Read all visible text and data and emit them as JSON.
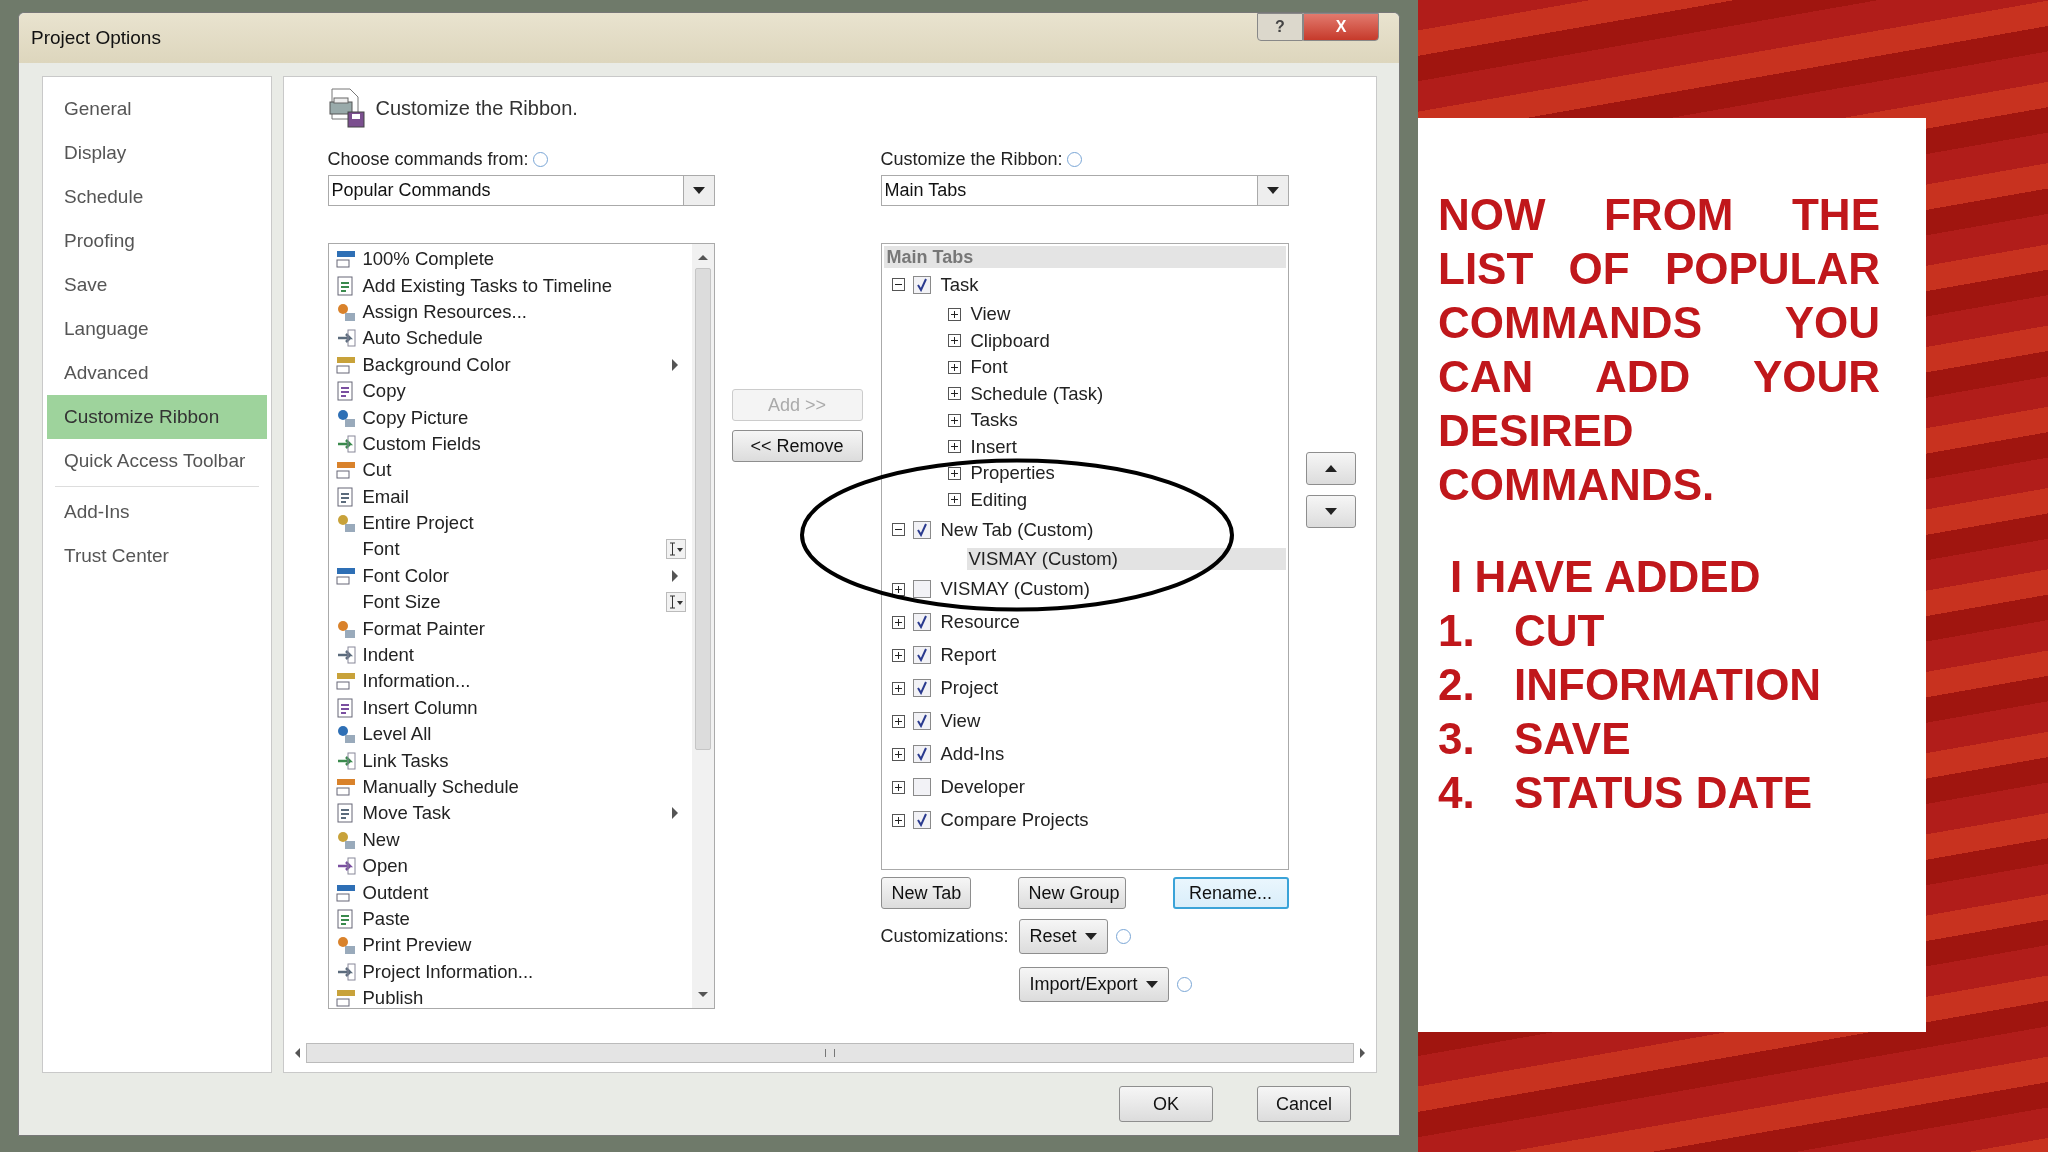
{
  "window": {
    "title": "Project Options",
    "buttons": [
      {
        "kind": "help",
        "label": "?"
      },
      {
        "kind": "close",
        "label": "X"
      }
    ]
  },
  "nav": {
    "groups": [
      [
        {
          "label": "General",
          "selected": false
        },
        {
          "label": "Display",
          "selected": false
        },
        {
          "label": "Schedule",
          "selected": false
        },
        {
          "label": "Proofing",
          "selected": false
        },
        {
          "label": "Save",
          "selected": false
        },
        {
          "label": "Language",
          "selected": false
        },
        {
          "label": "Advanced",
          "selected": false
        },
        {
          "label": "Customize Ribbon",
          "selected": true
        },
        {
          "label": "Quick Access Toolbar",
          "selected": false
        }
      ],
      [
        {
          "label": "Add-Ins",
          "selected": false
        },
        {
          "label": "Trust Center",
          "selected": false
        }
      ]
    ]
  },
  "heading": "Customize the Ribbon.",
  "commands_from": {
    "label": "Choose commands from:",
    "value": "Popular Commands"
  },
  "commands": [
    {
      "label": "100% Complete",
      "icon": true,
      "kind": "plain"
    },
    {
      "label": "Add Existing Tasks to Timeline",
      "icon": true,
      "kind": "plain"
    },
    {
      "label": "Assign Resources...",
      "icon": true,
      "kind": "plain"
    },
    {
      "label": "Auto Schedule",
      "icon": true,
      "kind": "plain"
    },
    {
      "label": "Background Color",
      "icon": true,
      "kind": "menu"
    },
    {
      "label": "Copy",
      "icon": true,
      "kind": "plain"
    },
    {
      "label": "Copy Picture",
      "icon": true,
      "kind": "plain"
    },
    {
      "label": "Custom Fields",
      "icon": true,
      "kind": "plain"
    },
    {
      "label": "Cut",
      "icon": true,
      "kind": "plain"
    },
    {
      "label": "Email",
      "icon": true,
      "kind": "plain"
    },
    {
      "label": "Entire Project",
      "icon": true,
      "kind": "plain"
    },
    {
      "label": "Font",
      "icon": false,
      "kind": "combo"
    },
    {
      "label": "Font Color",
      "icon": true,
      "kind": "menu"
    },
    {
      "label": "Font Size",
      "icon": false,
      "kind": "combo"
    },
    {
      "label": "Format Painter",
      "icon": true,
      "kind": "plain"
    },
    {
      "label": "Indent",
      "icon": true,
      "kind": "plain"
    },
    {
      "label": "Information...",
      "icon": true,
      "kind": "plain"
    },
    {
      "label": "Insert Column",
      "icon": true,
      "kind": "plain"
    },
    {
      "label": "Level All",
      "icon": true,
      "kind": "plain"
    },
    {
      "label": "Link Tasks",
      "icon": true,
      "kind": "plain"
    },
    {
      "label": "Manually Schedule",
      "icon": true,
      "kind": "plain"
    },
    {
      "label": "Move Task",
      "icon": true,
      "kind": "menu"
    },
    {
      "label": "New",
      "icon": true,
      "kind": "plain"
    },
    {
      "label": "Open",
      "icon": true,
      "kind": "plain"
    },
    {
      "label": "Outdent",
      "icon": true,
      "kind": "plain"
    },
    {
      "label": "Paste",
      "icon": true,
      "kind": "plain"
    },
    {
      "label": "Print Preview",
      "icon": true,
      "kind": "plain"
    },
    {
      "label": "Project Information...",
      "icon": true,
      "kind": "plain"
    },
    {
      "label": "Publish",
      "icon": true,
      "kind": "plain"
    }
  ],
  "transfer_buttons": [
    {
      "label": "Add >>",
      "disabled": true
    },
    {
      "label": "<< Remove",
      "disabled": false
    }
  ],
  "ribbon": {
    "label": "Customize the Ribbon:",
    "value": "Main Tabs",
    "tree_header": "Main Tabs",
    "tree": [
      {
        "kind": "tab",
        "label": "Task",
        "checked": true,
        "expanded": true,
        "selected": false,
        "children": [
          {
            "kind": "group",
            "label": "View",
            "selected": false
          },
          {
            "kind": "group",
            "label": "Clipboard",
            "selected": false
          },
          {
            "kind": "group",
            "label": "Font",
            "selected": false
          },
          {
            "kind": "group",
            "label": "Schedule (Task)",
            "selected": false
          },
          {
            "kind": "group",
            "label": "Tasks",
            "selected": false
          },
          {
            "kind": "group",
            "label": "Insert",
            "selected": false
          },
          {
            "kind": "group",
            "label": "Properties",
            "selected": false
          },
          {
            "kind": "group",
            "label": "Editing",
            "selected": false
          }
        ]
      },
      {
        "kind": "tab",
        "label": "New Tab (Custom)",
        "checked": true,
        "expanded": true,
        "selected": false,
        "children": [
          {
            "kind": "empty_group",
            "label": "VISMAY (Custom)",
            "selected": true
          }
        ]
      },
      {
        "kind": "tab",
        "label": "VISMAY (Custom)",
        "checked": false,
        "expanded": false,
        "selected": false
      },
      {
        "kind": "tab",
        "label": "Resource",
        "checked": true,
        "expanded": false,
        "selected": false
      },
      {
        "kind": "tab",
        "label": "Report",
        "checked": true,
        "expanded": false,
        "selected": false
      },
      {
        "kind": "tab",
        "label": "Project",
        "checked": true,
        "expanded": false,
        "selected": false
      },
      {
        "kind": "tab",
        "label": "View",
        "checked": true,
        "expanded": false,
        "selected": false
      },
      {
        "kind": "tab",
        "label": "Add-Ins",
        "checked": true,
        "expanded": false,
        "selected": false
      },
      {
        "kind": "tab",
        "label": "Developer",
        "checked": false,
        "expanded": false,
        "selected": false
      },
      {
        "kind": "tab",
        "label": "Compare Projects",
        "checked": true,
        "expanded": false,
        "selected": false
      }
    ]
  },
  "tree_buttons": [
    {
      "label": "New Tab",
      "focused": false
    },
    {
      "label": "New Group",
      "focused": false
    },
    {
      "label": "Rename...",
      "focused": true
    }
  ],
  "customizations": {
    "label": "Customizations:",
    "buttons": [
      "Reset",
      "Import/Export"
    ]
  },
  "dialog_buttons": [
    "OK",
    "Cancel"
  ],
  "note": {
    "paragraph": "NOW FROM THE LIST OF POPULAR COMMANDS YOU CAN ADD YOUR DESIRED COMMANDS.",
    "subheading": "I HAVE ADDED",
    "items": [
      {
        "number": "1.",
        "text": "CUT"
      },
      {
        "number": "2.",
        "text": "INFORMATION"
      },
      {
        "number": "3.",
        "text": "SAVE"
      },
      {
        "number": "4.",
        "text": "STATUS DATE"
      }
    ]
  }
}
